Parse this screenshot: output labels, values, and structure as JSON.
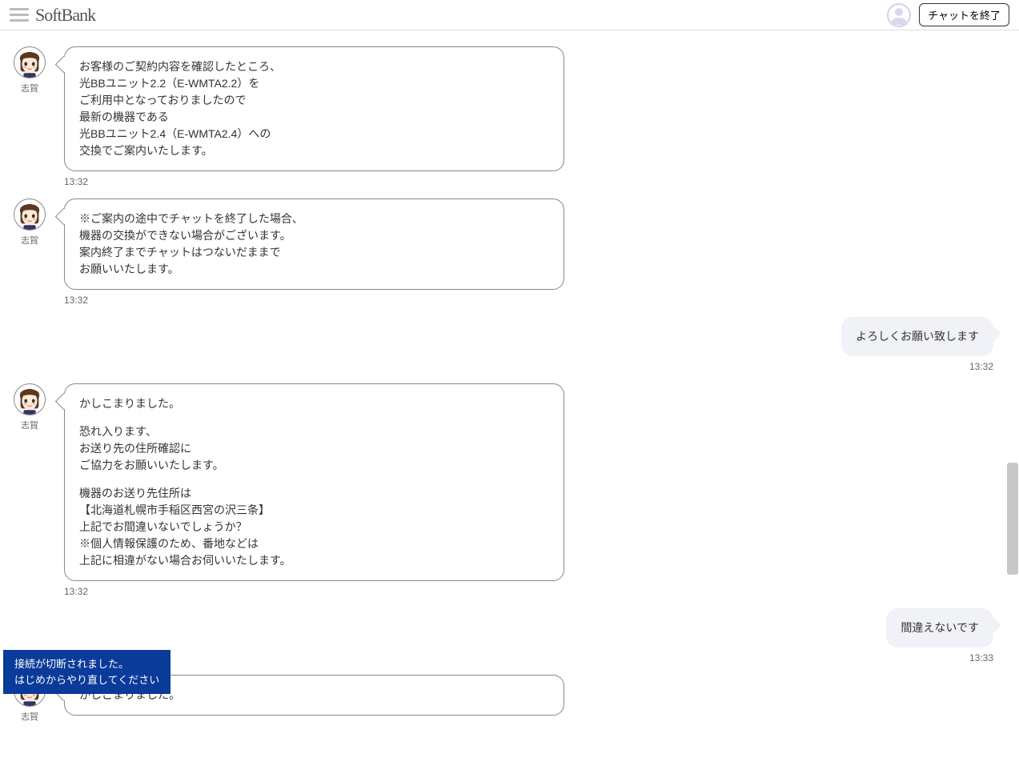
{
  "header": {
    "logo": "SoftBank",
    "end_chat_label": "チャットを終了"
  },
  "agent_name": "志賀",
  "messages": [
    {
      "role": "agent",
      "lines": [
        "お客様のご契約内容を確認したところ、",
        "光BBユニット2.2（E-WMTA2.2）を",
        "ご利用中となっておりましたので",
        "最新の機器である",
        "光BBユニット2.4（E-WMTA2.4）への",
        "交換でご案内いたします。"
      ],
      "time": "13:32"
    },
    {
      "role": "agent",
      "lines": [
        "※ご案内の途中でチャットを終了した場合、",
        "機器の交換ができない場合がございます。",
        "案内終了までチャットはつないだままで",
        "お願いいたします。"
      ],
      "time": "13:32"
    },
    {
      "role": "user",
      "lines": [
        "よろしくお願い致します"
      ],
      "time": "13:32"
    },
    {
      "role": "agent",
      "lines": [
        "かしこまりました。",
        "",
        "恐れ入ります、",
        "お送り先の住所確認に",
        "ご協力をお願いいたします。",
        "",
        "機器のお送り先住所は",
        "【北海道札幌市手稲区西宮の沢三条】",
        "上記でお間違いないでしょうか？",
        "※個人情報保護のため、番地などは",
        "上記に相違がない場合お伺いいたします。"
      ],
      "time": "13:32"
    },
    {
      "role": "user",
      "lines": [
        "間違えないです"
      ],
      "time": "13:33"
    },
    {
      "role": "agent",
      "lines": [
        "かしこまりました。"
      ],
      "time": "",
      "partial": true
    }
  ],
  "disconnect": {
    "line1": "接続が切断されました。",
    "line2": "はじめからやり直してください"
  }
}
